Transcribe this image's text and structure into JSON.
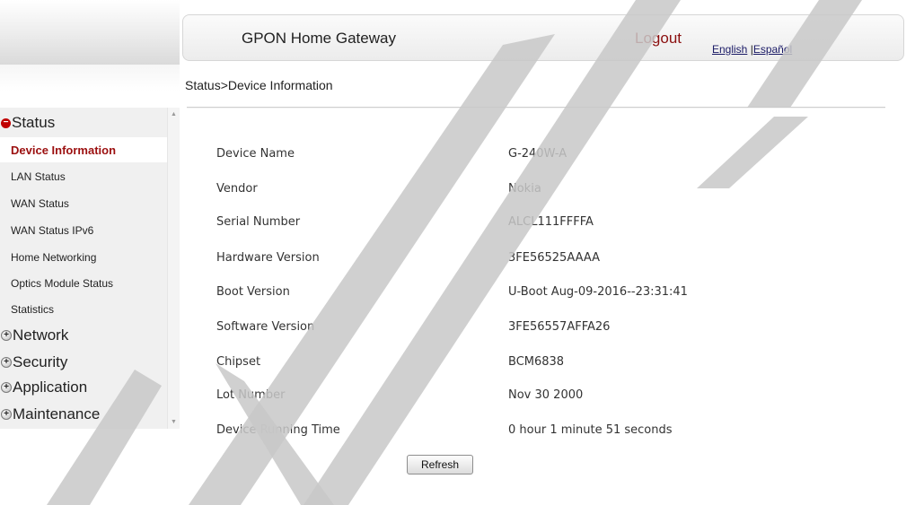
{
  "header": {
    "title": "GPON Home Gateway",
    "logout": "Logout",
    "lang_english": "English",
    "lang_sep": "|",
    "lang_spanish": "Español"
  },
  "breadcrumb": "Status>Device Information",
  "sidebar": {
    "status": "Status",
    "items": [
      "Device Information",
      "LAN Status",
      "WAN Status",
      "WAN Status IPv6",
      "Home Networking",
      "Optics Module Status",
      "Statistics"
    ],
    "network": "Network",
    "security": "Security",
    "application": "Application",
    "maintenance": "Maintenance"
  },
  "info": {
    "labels": [
      "Device Name",
      "Vendor",
      "Serial Number",
      "Hardware Version",
      "Boot Version",
      "Software Version",
      "Chipset",
      "Lot Number",
      "Device Running Time"
    ],
    "values": [
      "G-240W-A",
      "Nokia",
      "ALCL111FFFFA",
      "3FE56525AAAA",
      "U-Boot Aug-09-2016--23:31:41",
      "3FE56557AFFA26",
      "BCM6838",
      "Nov 30 2000",
      "0 hour 1 minute 51 seconds"
    ]
  },
  "refresh_label": "Refresh",
  "colors": {
    "accent_red": "#9b0f0f",
    "watermark": "#c8c8c8"
  }
}
